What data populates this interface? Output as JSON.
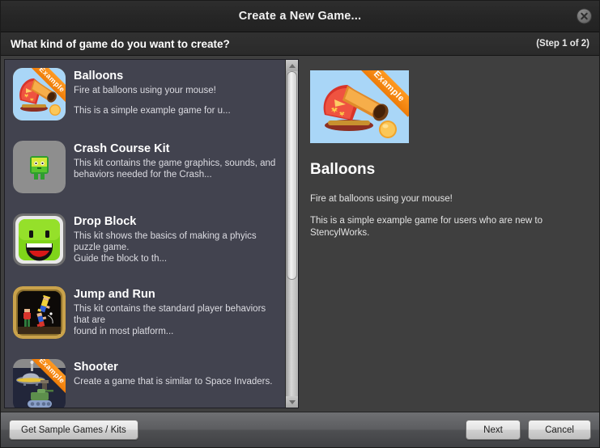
{
  "window": {
    "title": "Create a New Game...",
    "close_icon": "close-icon"
  },
  "subheader": {
    "question": "What kind of game do you want to create?",
    "step": "(Step 1 of 2)"
  },
  "list": {
    "items": [
      {
        "name": "Balloons",
        "desc": "Fire at balloons using your mouse!",
        "desc2": "This is a simple example game for u...",
        "badge": "Example",
        "selected": true,
        "icon": "balloons-cannon-icon"
      },
      {
        "name": "Crash Course Kit",
        "desc": "This kit contains the game graphics, sounds, and",
        "desc2": "behaviors needed for the Crash...",
        "badge": "",
        "selected": false,
        "icon": "crash-course-character-icon"
      },
      {
        "name": "Drop Block",
        "desc": "This kit shows the basics of making a phyics puzzle game.",
        "desc2": "Guide the block to th...",
        "badge": "",
        "selected": false,
        "icon": "drop-block-smiley-icon"
      },
      {
        "name": "Jump and Run",
        "desc": "This kit contains the standard player behaviors that are",
        "desc2": "found in most platform...",
        "badge": "",
        "selected": false,
        "icon": "jump-and-run-platformer-icon"
      },
      {
        "name": "Shooter",
        "desc": "Create a game that is similar to Space Invaders.",
        "desc2": "",
        "badge": "Example",
        "selected": false,
        "icon": "shooter-ufo-tank-icon"
      }
    ]
  },
  "detail": {
    "badge": "Example",
    "name": "Balloons",
    "desc1": "Fire at balloons using your mouse!",
    "desc2": "This is a simple example game for users who are new to StencylWorks."
  },
  "footer": {
    "sample_label": "Get Sample Games / Kits",
    "next_label": "Next",
    "cancel_label": "Cancel"
  },
  "colors": {
    "accent_orange": "#ee7c09",
    "list_bg": "#42434f",
    "panel_bg": "#3f3f3f",
    "titlebar_bg": "#262626",
    "selected_border": "#c9a24b"
  }
}
